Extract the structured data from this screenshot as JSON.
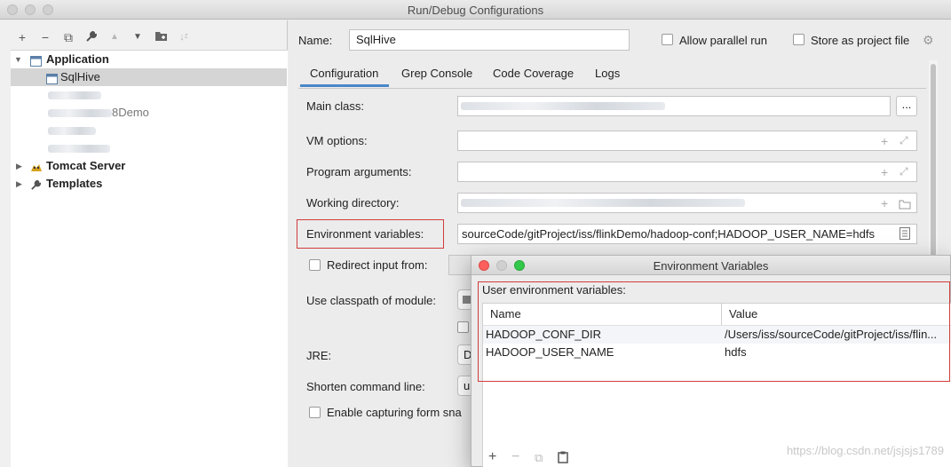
{
  "window": {
    "title": "Run/Debug Configurations"
  },
  "toolbar": {
    "icons": [
      "add-icon",
      "remove-icon",
      "copy-icon",
      "wrench-icon",
      "move-up-icon",
      "move-down-icon",
      "folder-add-icon",
      "sort-icon"
    ],
    "glyphs": {
      "add": "+",
      "remove": "−",
      "copy": "⧉",
      "wrench": "🔧",
      "up": "▲",
      "down": "▼",
      "folder": "▣",
      "sort": "↓ᶻ"
    }
  },
  "tree": {
    "application": "Application",
    "sqlhive": "SqlHive",
    "demo_partial": "8Demo",
    "tomcat": "Tomcat Server",
    "templates": "Templates"
  },
  "form": {
    "name_label": "Name:",
    "name_value": "SqlHive",
    "parallel_label": "Allow parallel run",
    "store_label": "Store as project file",
    "tabs": [
      "Configuration",
      "Grep Console",
      "Code Coverage",
      "Logs"
    ],
    "main_class_label": "Main class:",
    "main_class_btn": "...",
    "vm_options_label": "VM options:",
    "program_args_label": "Program arguments:",
    "working_dir_label": "Working directory:",
    "env_vars_label": "Environment variables:",
    "env_vars_value": "sourceCode/gitProject/iss/flinkDemo/hadoop-conf;HADOOP_USER_NAME=hdfs",
    "redirect_label": "Redirect input from:",
    "classpath_label": "Use classpath of module:",
    "jre_label": "JRE:",
    "jre_value": "D",
    "shorten_label": "Shorten command line:",
    "shorten_value": "u",
    "capture_label": "Enable capturing form sna"
  },
  "env_dialog": {
    "title": "Environment Variables",
    "section_label": "User environment variables:",
    "col_name": "Name",
    "col_value": "Value",
    "rows": [
      {
        "name": "HADOOP_CONF_DIR",
        "value": "/Users/iss/sourceCode/gitProject/iss/flin..."
      },
      {
        "name": "HADOOP_USER_NAME",
        "value": "hdfs"
      }
    ],
    "add": "+",
    "remove": "−",
    "copy": "⧉",
    "paste": "📋"
  },
  "watermark": "https://blog.csdn.net/jsjsjs1789",
  "colors": {
    "accent": "#4a86c8",
    "highlight_box": "#d13c3c",
    "selection": "#d5d5d5"
  }
}
